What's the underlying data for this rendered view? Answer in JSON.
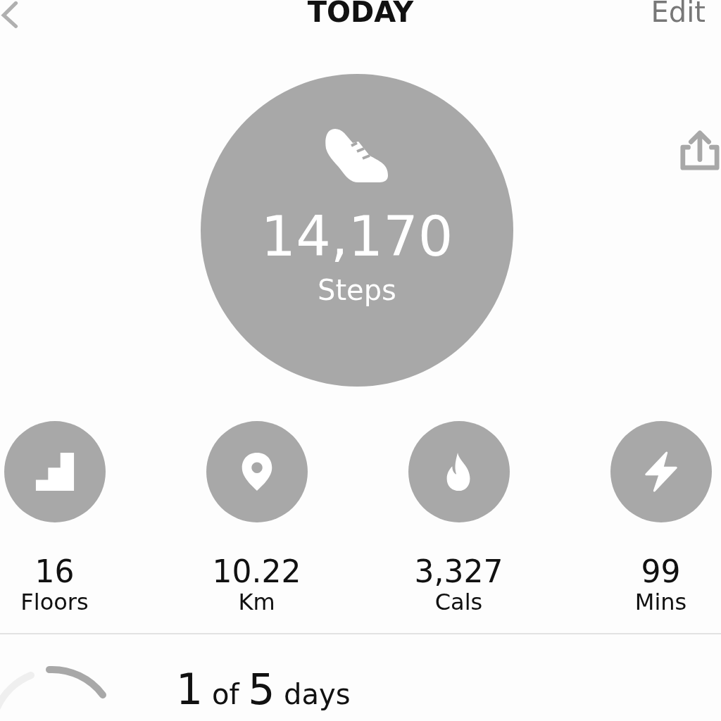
{
  "header": {
    "title": "TODAY",
    "action": "Edit"
  },
  "main": {
    "value": "14,170",
    "label": "Steps"
  },
  "metrics": [
    {
      "kind": "floors",
      "value": "16",
      "label": "Floors"
    },
    {
      "kind": "distance",
      "value": "10.22",
      "label": "Km"
    },
    {
      "kind": "calories",
      "value": "3,327",
      "label": "Cals"
    },
    {
      "kind": "minutes",
      "value": "99",
      "label": "Mins"
    }
  ],
  "goal": {
    "count": "1",
    "of": "of",
    "total": "5",
    "unit": "days"
  }
}
